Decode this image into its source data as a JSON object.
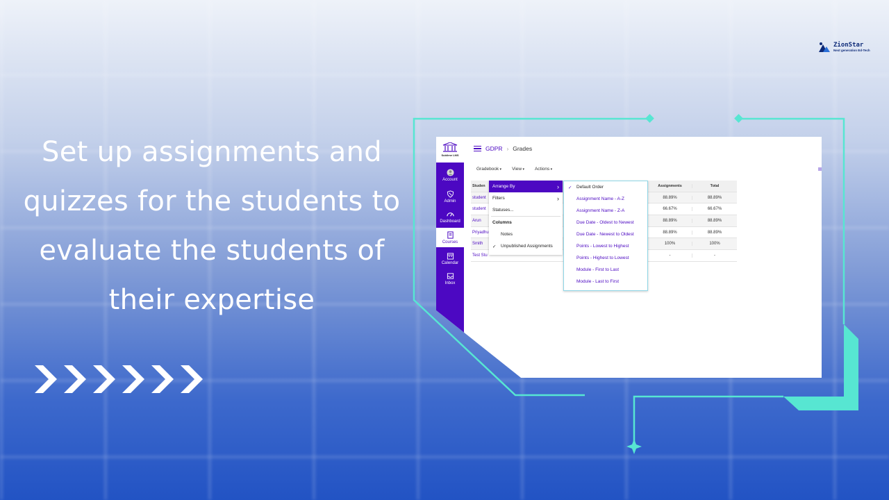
{
  "brand": {
    "name": "ZionStar",
    "tagline": "Next generation Ed-Tech"
  },
  "headline": {
    "lines": [
      "Set up assignments and",
      "quizzes for the students to",
      "evaluate the students of",
      "their expertise"
    ]
  },
  "colors": {
    "accent": "#4c08c2",
    "frame": "#57e6d2",
    "text_light": "#ffffff"
  },
  "lms": {
    "logo_text": "Sublime LMS",
    "nav": [
      {
        "label": "Account",
        "icon": "account-icon"
      },
      {
        "label": "Admin",
        "icon": "shield-icon"
      },
      {
        "label": "Dashboard",
        "icon": "dashboard-icon"
      },
      {
        "label": "Courses",
        "icon": "book-icon",
        "active": true
      },
      {
        "label": "Calendar",
        "icon": "calendar-icon"
      },
      {
        "label": "Inbox",
        "icon": "inbox-icon"
      }
    ],
    "breadcrumb": {
      "course": "GDPR",
      "separator": "›",
      "page": "Grades"
    },
    "menubar": [
      "Gradebook",
      "View",
      "Actions"
    ],
    "table": {
      "headers": [
        "Studen",
        "Assignments",
        "Total"
      ],
      "rows": [
        {
          "name": "student",
          "assignments": "88.89%",
          "total": "88.89%"
        },
        {
          "name": "student",
          "assignments": "66.67%",
          "total": "66.67%"
        },
        {
          "name": "Arun",
          "assignments": "88.89%",
          "total": "88.89%"
        },
        {
          "name": "Priyadhu",
          "assignments": "88.89%",
          "total": "88.89%"
        },
        {
          "name": "Smith",
          "assignments": "100%",
          "total": "100%"
        },
        {
          "name": "Test Stu",
          "assignments": "-",
          "total": "-"
        }
      ]
    },
    "view_menu": {
      "arrange_by": "Arrange By",
      "filters": "Filters",
      "statuses": "Statuses...",
      "columns_header": "Columns",
      "notes": "Notes",
      "unpublished": "Unpublished Assignments"
    },
    "arrange_options": [
      "Default Order",
      "Assignment Name - A-Z",
      "Assignment Name - Z-A",
      "Due Date - Oldest to Newest",
      "Due Date - Newest to Oldest",
      "Points - Lowest to Highest",
      "Points - Highest to Lowest",
      "Module - First to Last",
      "Module - Last to First"
    ],
    "arrange_selected_index": 0
  }
}
